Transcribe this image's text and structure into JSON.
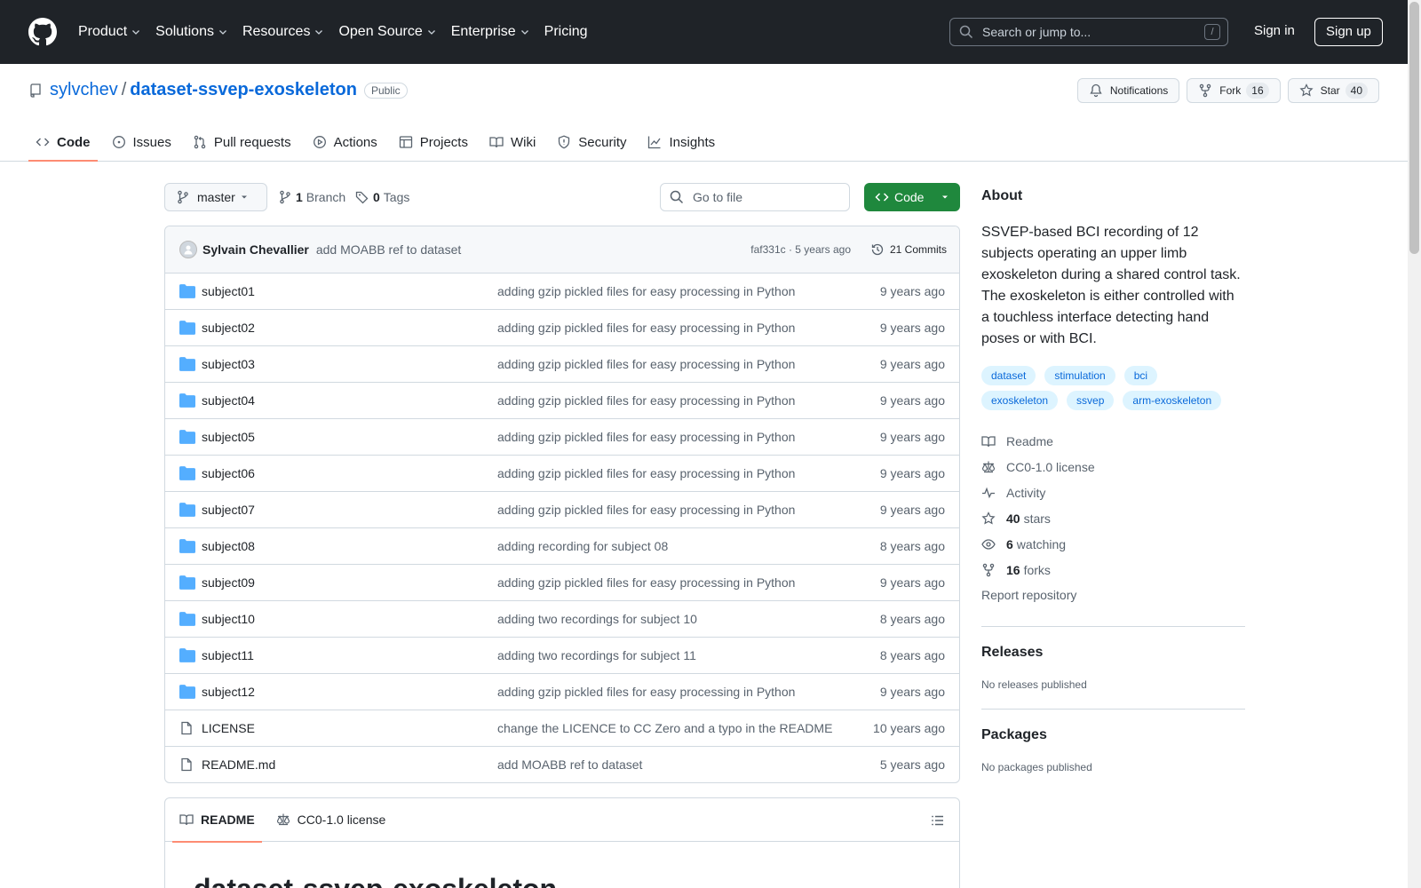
{
  "header": {
    "nav": [
      "Product",
      "Solutions",
      "Resources",
      "Open Source",
      "Enterprise"
    ],
    "pricing": "Pricing",
    "search_placeholder": "Search or jump to...",
    "search_shortcut": "/",
    "sign_in": "Sign in",
    "sign_up": "Sign up"
  },
  "repo": {
    "owner": "sylvchev",
    "separator": "/",
    "name": "dataset-ssvep-exoskeleton",
    "visibility": "Public",
    "notifications": "Notifications",
    "fork_label": "Fork",
    "fork_count": "16",
    "star_label": "Star",
    "star_count": "40"
  },
  "tabs": [
    "Code",
    "Issues",
    "Pull requests",
    "Actions",
    "Projects",
    "Wiki",
    "Security",
    "Insights"
  ],
  "toolbar": {
    "branch": "master",
    "branch_count": "1",
    "branch_label": "Branch",
    "tag_count": "0",
    "tag_label": "Tags",
    "goto_placeholder": "Go to file",
    "code_button": "Code"
  },
  "latest_commit": {
    "author": "Sylvain Chevallier",
    "message": "add MOABB ref to dataset",
    "sha_age": "faf331c · 5 years ago",
    "commits": "21 Commits"
  },
  "files": [
    {
      "type": "dir",
      "name": "subject01",
      "msg": "adding gzip pickled files for easy processing in Python",
      "age": "9 years ago"
    },
    {
      "type": "dir",
      "name": "subject02",
      "msg": "adding gzip pickled files for easy processing in Python",
      "age": "9 years ago"
    },
    {
      "type": "dir",
      "name": "subject03",
      "msg": "adding gzip pickled files for easy processing in Python",
      "age": "9 years ago"
    },
    {
      "type": "dir",
      "name": "subject04",
      "msg": "adding gzip pickled files for easy processing in Python",
      "age": "9 years ago"
    },
    {
      "type": "dir",
      "name": "subject05",
      "msg": "adding gzip pickled files for easy processing in Python",
      "age": "9 years ago"
    },
    {
      "type": "dir",
      "name": "subject06",
      "msg": "adding gzip pickled files for easy processing in Python",
      "age": "9 years ago"
    },
    {
      "type": "dir",
      "name": "subject07",
      "msg": "adding gzip pickled files for easy processing in Python",
      "age": "9 years ago"
    },
    {
      "type": "dir",
      "name": "subject08",
      "msg": "adding recording for subject 08",
      "age": "8 years ago"
    },
    {
      "type": "dir",
      "name": "subject09",
      "msg": "adding gzip pickled files for easy processing in Python",
      "age": "9 years ago"
    },
    {
      "type": "dir",
      "name": "subject10",
      "msg": "adding two recordings for subject 10",
      "age": "8 years ago"
    },
    {
      "type": "dir",
      "name": "subject11",
      "msg": "adding two recordings for subject 11",
      "age": "8 years ago"
    },
    {
      "type": "dir",
      "name": "subject12",
      "msg": "adding gzip pickled files for easy processing in Python",
      "age": "9 years ago"
    },
    {
      "type": "file",
      "name": "LICENSE",
      "msg": "change the LICENCE to CC Zero and a typo in the README",
      "age": "10 years ago"
    },
    {
      "type": "file",
      "name": "README.md",
      "msg": "add MOABB ref to dataset",
      "age": "5 years ago"
    }
  ],
  "readme": {
    "tab_readme": "README",
    "tab_license": "CC0-1.0 license",
    "heading": "dataset-ssvep-exoskeleton"
  },
  "about": {
    "title": "About",
    "description": "SSVEP-based BCI recording of 12 subjects operating an upper limb exoskeleton during a shared control task. The exoskeleton is either controlled with a touchless interface detecting hand poses or with BCI.",
    "topics": [
      "dataset",
      "stimulation",
      "bci",
      "exoskeleton",
      "ssvep",
      "arm-exoskeleton"
    ],
    "readme": "Readme",
    "license": "CC0-1.0 license",
    "activity": "Activity",
    "stars_count": "40",
    "stars_label": "stars",
    "watching_count": "6",
    "watching_label": "watching",
    "forks_count": "16",
    "forks_label": "forks",
    "report": "Report repository"
  },
  "releases": {
    "title": "Releases",
    "empty": "No releases published"
  },
  "packages": {
    "title": "Packages",
    "empty": "No packages published"
  },
  "colors": {
    "header_bg": "#1f2328",
    "link": "#0969da",
    "code_button": "#1f883d",
    "tab_underline": "#fd8c73",
    "folder": "#54aeff"
  }
}
